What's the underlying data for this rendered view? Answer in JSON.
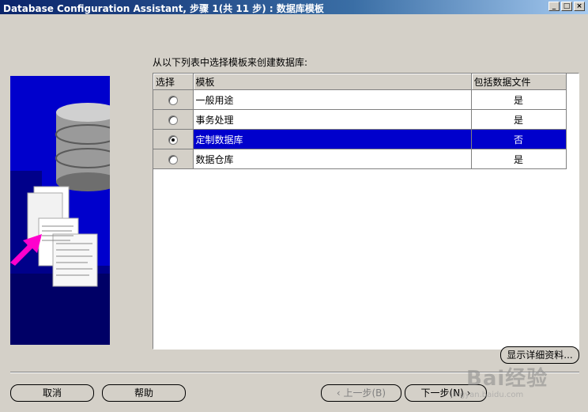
{
  "window": {
    "title": "Database Configuration Assistant, 步骤 1(共 11 步) : 数据库模板",
    "controls": {
      "minimize": "_",
      "maximize": "□",
      "close": "×"
    }
  },
  "prompt": "从以下列表中选择模板来创建数据库:",
  "table": {
    "headers": {
      "select": "选择",
      "template": "模板",
      "includes_datafiles": "包括数据文件"
    },
    "rows": [
      {
        "name": "一般用途",
        "includes": "是",
        "selected": false
      },
      {
        "name": "事务处理",
        "includes": "是",
        "selected": false
      },
      {
        "name": "定制数据库",
        "includes": "否",
        "selected": true
      },
      {
        "name": "数据仓库",
        "includes": "是",
        "selected": false
      }
    ]
  },
  "buttons": {
    "details": "显示详细资料...",
    "cancel": "取消",
    "help": "帮助",
    "back": "上一步(B)",
    "next": "下一步(N)"
  },
  "watermark": {
    "brand": "Bai经验",
    "url": "jingyan.baidu.com"
  },
  "colors": {
    "selection": "#0000cc",
    "titlebar": "#0a246a",
    "face": "#d4d0c8"
  }
}
